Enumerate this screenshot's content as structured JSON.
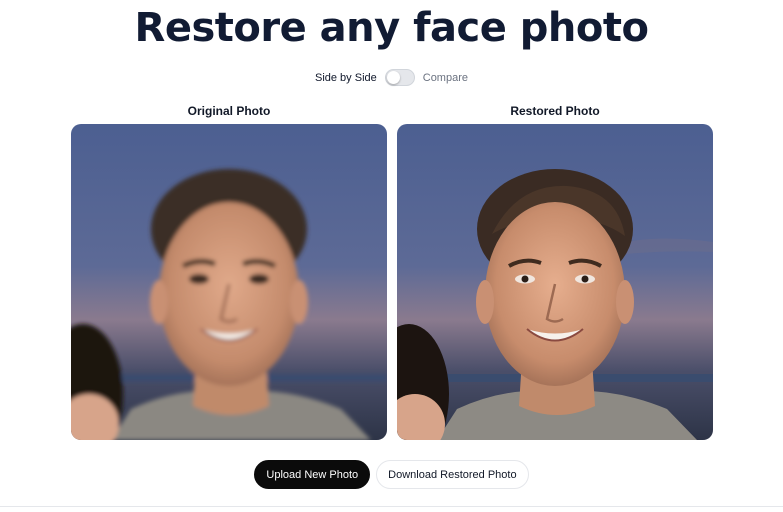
{
  "page": {
    "title": "Restore any face photo"
  },
  "view_toggle": {
    "left_label": "Side by Side",
    "right_label": "Compare",
    "state": "side-by-side"
  },
  "panels": {
    "original_label": "Original Photo",
    "restored_label": "Restored Photo"
  },
  "actions": {
    "upload_label": "Upload New Photo",
    "download_label": "Download Restored Photo"
  },
  "colors": {
    "title": "#111b33",
    "primary_button": "#0b0b0b",
    "toggle_track": "#e5e7eb"
  }
}
